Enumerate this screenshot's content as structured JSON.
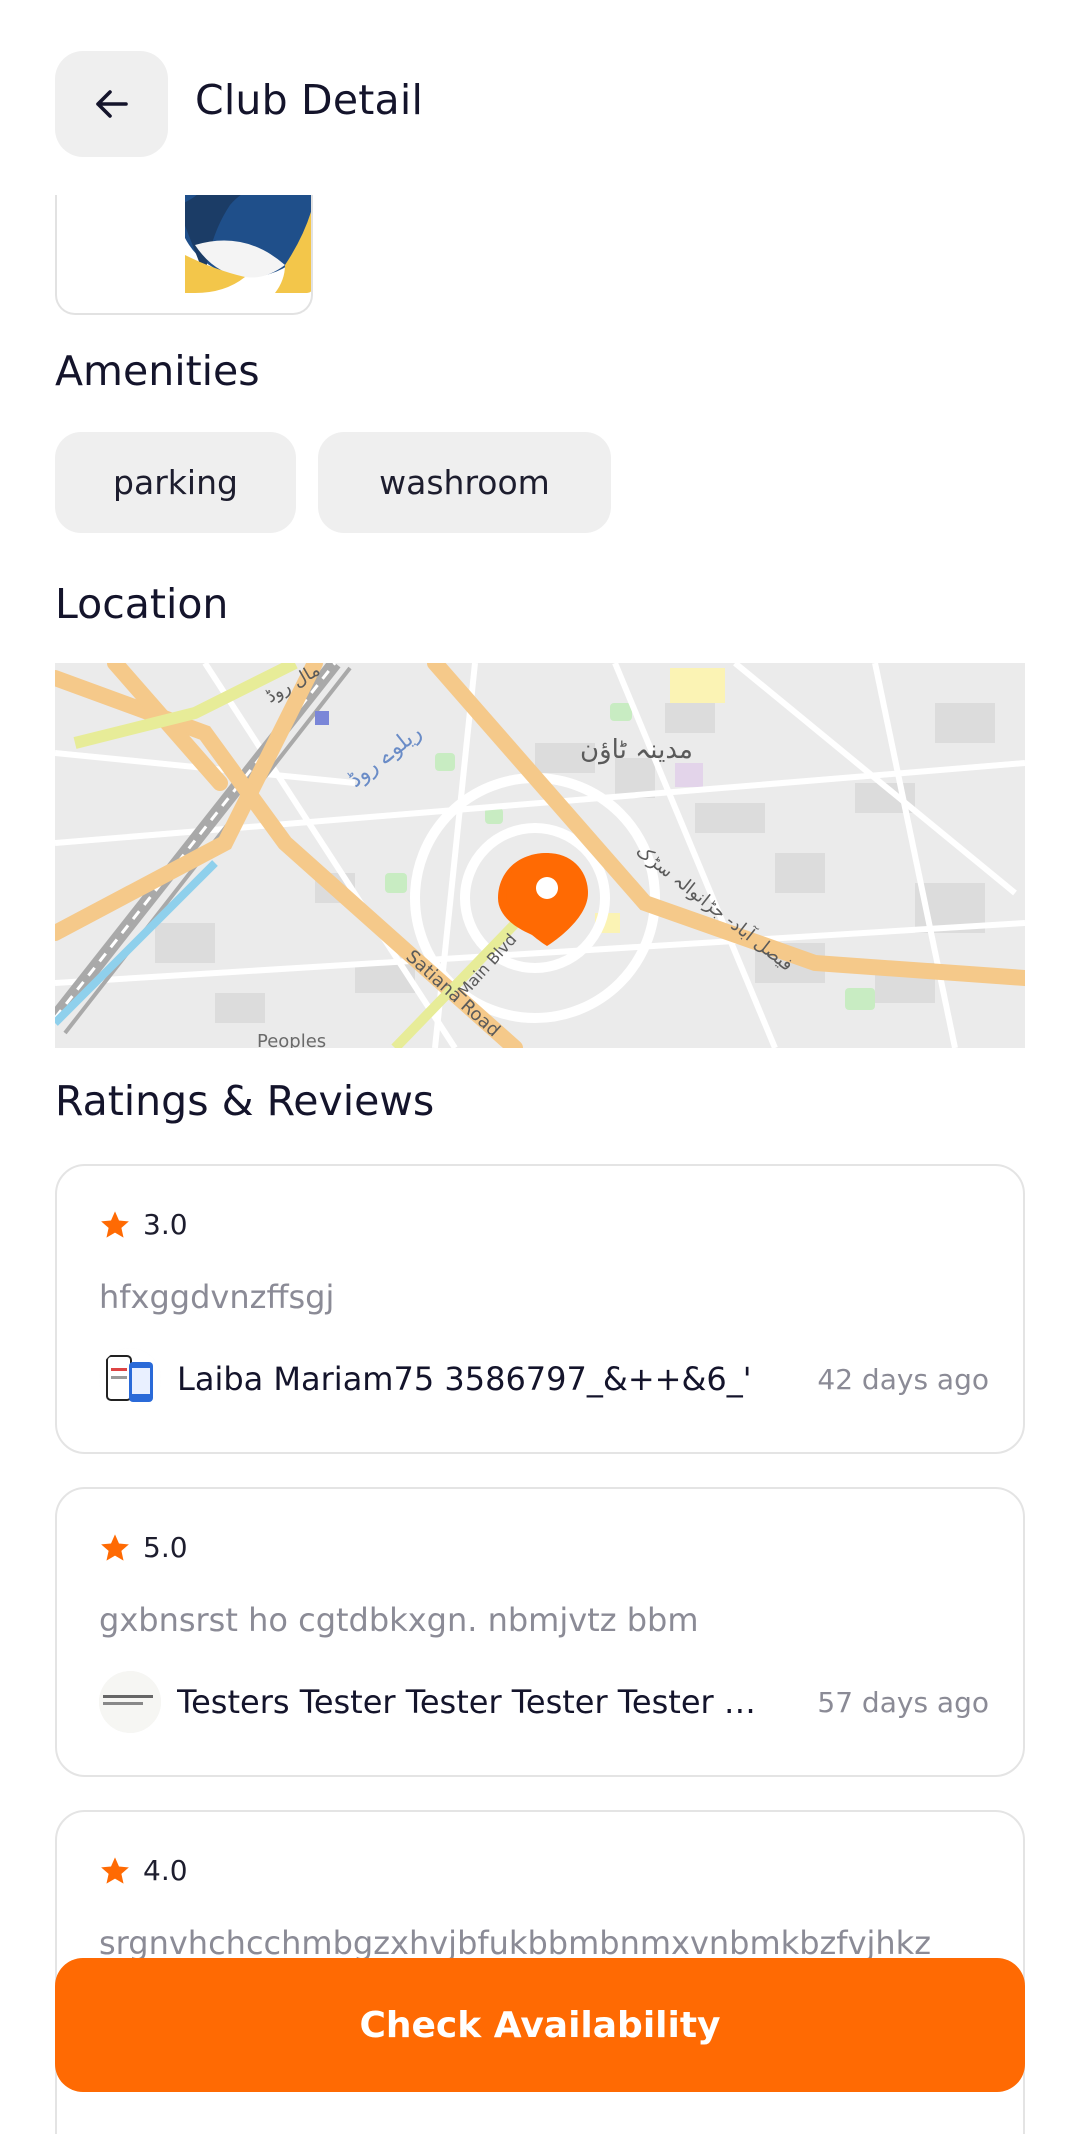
{
  "header": {
    "title": "Club Detail"
  },
  "amenities": {
    "title": "Amenities",
    "items": [
      "parking",
      "washroom"
    ]
  },
  "location": {
    "title": "Location",
    "map_labels": {
      "area": "مدینہ ٹاؤن",
      "road_1": "فیصل آباد- جڑانوالہ سڑک",
      "road_2": "Satiana Road",
      "road_3": "Main Blvd",
      "road_4": "ریلوے روڈ",
      "road_5": "مال روڈ",
      "road_6": "Peoples"
    }
  },
  "reviews": {
    "title": "Ratings & Reviews",
    "items": [
      {
        "rating": "3.0",
        "text": "hfxggdvnzffsgj",
        "name": "Laiba Mariam75 3586797_&++&6_'",
        "time": "42 days ago"
      },
      {
        "rating": "5.0",
        "text": "gxbnsrst ho cgtdbkxgn. nbmjvtz bbm",
        "name": "Testers Tester Tester Tester Tester Tester",
        "time": "57 days ago"
      },
      {
        "rating": "4.0",
        "text": "srgnvhchcchmbgzxhvjbfukbbmbnmxvnbmkbzfvjhkz",
        "name": "",
        "time": ""
      }
    ]
  },
  "cta": {
    "label": "Check Availability"
  },
  "colors": {
    "accent": "#ff6a03",
    "chip_bg": "#efefef",
    "text_primary": "#14142b",
    "text_secondary": "#8b8b96"
  },
  "icons": [
    "back-arrow-icon",
    "star-icon",
    "map-pin-icon"
  ]
}
